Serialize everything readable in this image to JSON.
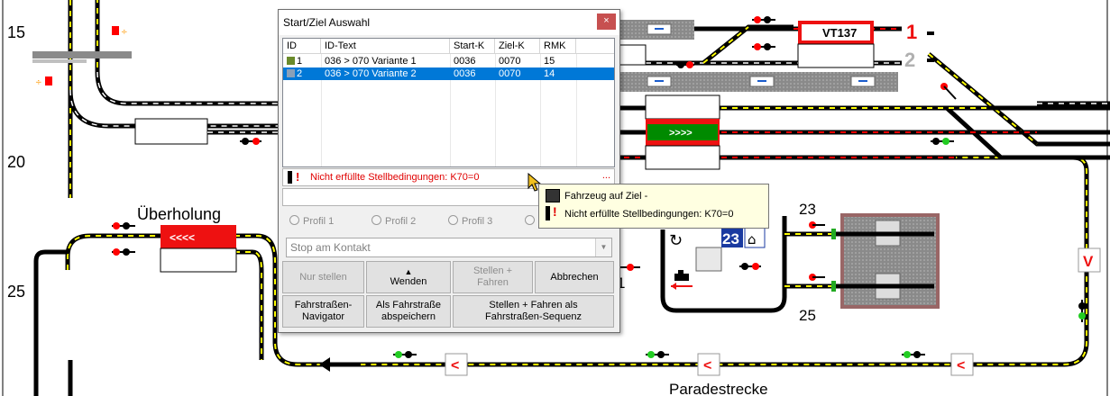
{
  "labels": {
    "row15": "15",
    "row20": "20",
    "row25": "25",
    "overtaking": "Überholung",
    "parade": "Paradestrecke",
    "track1": "1",
    "track2": "2",
    "num23_right": "23",
    "num25_right": "25",
    "num23_box": "23",
    "num1_mid": "1",
    "train_vt": "VT137",
    "arrows_left": "<<<<",
    "arrows_right": ">>>>",
    "marker_v": "V",
    "marker_lt": "<"
  },
  "dialog": {
    "title": "Start/Ziel Auswahl",
    "close": "×",
    "columns": [
      "ID",
      "ID-Text",
      "Start-K",
      "Ziel-K",
      "RMK"
    ],
    "rows": [
      {
        "id": "1",
        "text": "036 > 070 Variante 1",
        "start": "0036",
        "ziel": "0070",
        "rmk": "15",
        "selected": false
      },
      {
        "id": "2",
        "text": "036 > 070 Variante 2",
        "start": "0036",
        "ziel": "0070",
        "rmk": "14",
        "selected": true
      }
    ],
    "status_text": "Nicht erfüllte Stellbedingungen: K70=0",
    "status_more": "...",
    "profiles": [
      "Profil 1",
      "Profil 2",
      "Profil 3"
    ],
    "combo_value": "Stop am Kontakt",
    "buttons": {
      "nur_stellen": "Nur stellen",
      "wenden": "Wenden",
      "stellen_fahren_1": "Stellen +",
      "stellen_fahren_2": "Fahren",
      "abbrechen": "Abbrechen",
      "navigator_1": "Fahrstraßen-",
      "navigator_2": "Navigator",
      "speichern_1": "Als Fahrstraße",
      "speichern_2": "abspeichern",
      "sequenz_1": "Stellen + Fahren als",
      "sequenz_2": "Fahrstraßen-Sequenz"
    }
  },
  "tooltip": {
    "line1": "Fahrzeug auf Ziel -",
    "line2": "Nicht erfüllte Stellbedingungen: K70=0"
  },
  "colors": {
    "track": "#000000",
    "track_dash": "#ffff00",
    "route_red": "#ff0000",
    "route_green": "#008000",
    "selection": "#0078d7",
    "error": "#e00000",
    "tooltip_bg": "#ffffe1"
  }
}
